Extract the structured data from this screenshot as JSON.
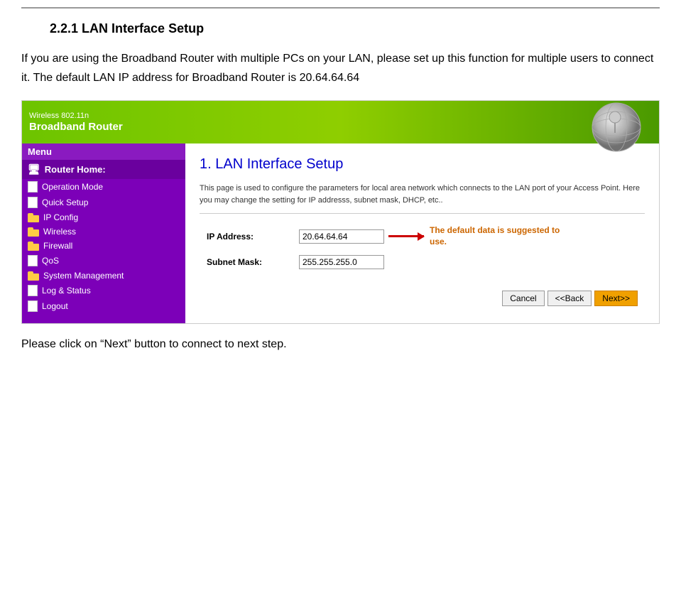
{
  "section_title": "2.2.1     LAN Interface Setup",
  "intro_paragraph": "If you are using the Broadband Router with multiple PCs on your LAN, please set up this function for multiple users to connect it. The default LAN IP address for Broadband Router is 20.64.64.64",
  "router_ui": {
    "header": {
      "line1": "Wireless 802.11n",
      "line2": "Broadband Router"
    },
    "sidebar": {
      "menu_label": "Menu",
      "router_home_label": "Router Home:",
      "items": [
        {
          "label": "Operation Mode",
          "icon": "page"
        },
        {
          "label": "Quick Setup",
          "icon": "page"
        },
        {
          "label": "IP Config",
          "icon": "folder"
        },
        {
          "label": "Wireless",
          "icon": "folder"
        },
        {
          "label": "Firewall",
          "icon": "folder"
        },
        {
          "label": "QoS",
          "icon": "page"
        },
        {
          "label": "System Management",
          "icon": "folder"
        },
        {
          "label": "Log & Status",
          "icon": "page"
        },
        {
          "label": "Logout",
          "icon": "page"
        }
      ]
    },
    "main": {
      "heading": "1. LAN Interface Setup",
      "description": "This page is used to configure the parameters for local area network which connects to the LAN port of your Access Point. Here you may change the setting for IP addresss, subnet mask, DHCP, etc..",
      "fields": [
        {
          "label": "IP Address:",
          "value": "20.64.64.64"
        },
        {
          "label": "Subnet Mask:",
          "value": "255.255.255.0"
        }
      ],
      "annotation": "The default data is suggested to use.",
      "buttons": {
        "cancel": "Cancel",
        "back": "<<Back",
        "next": "Next>>"
      }
    }
  },
  "footer_text": "Please click on “Next” button to connect to next step."
}
